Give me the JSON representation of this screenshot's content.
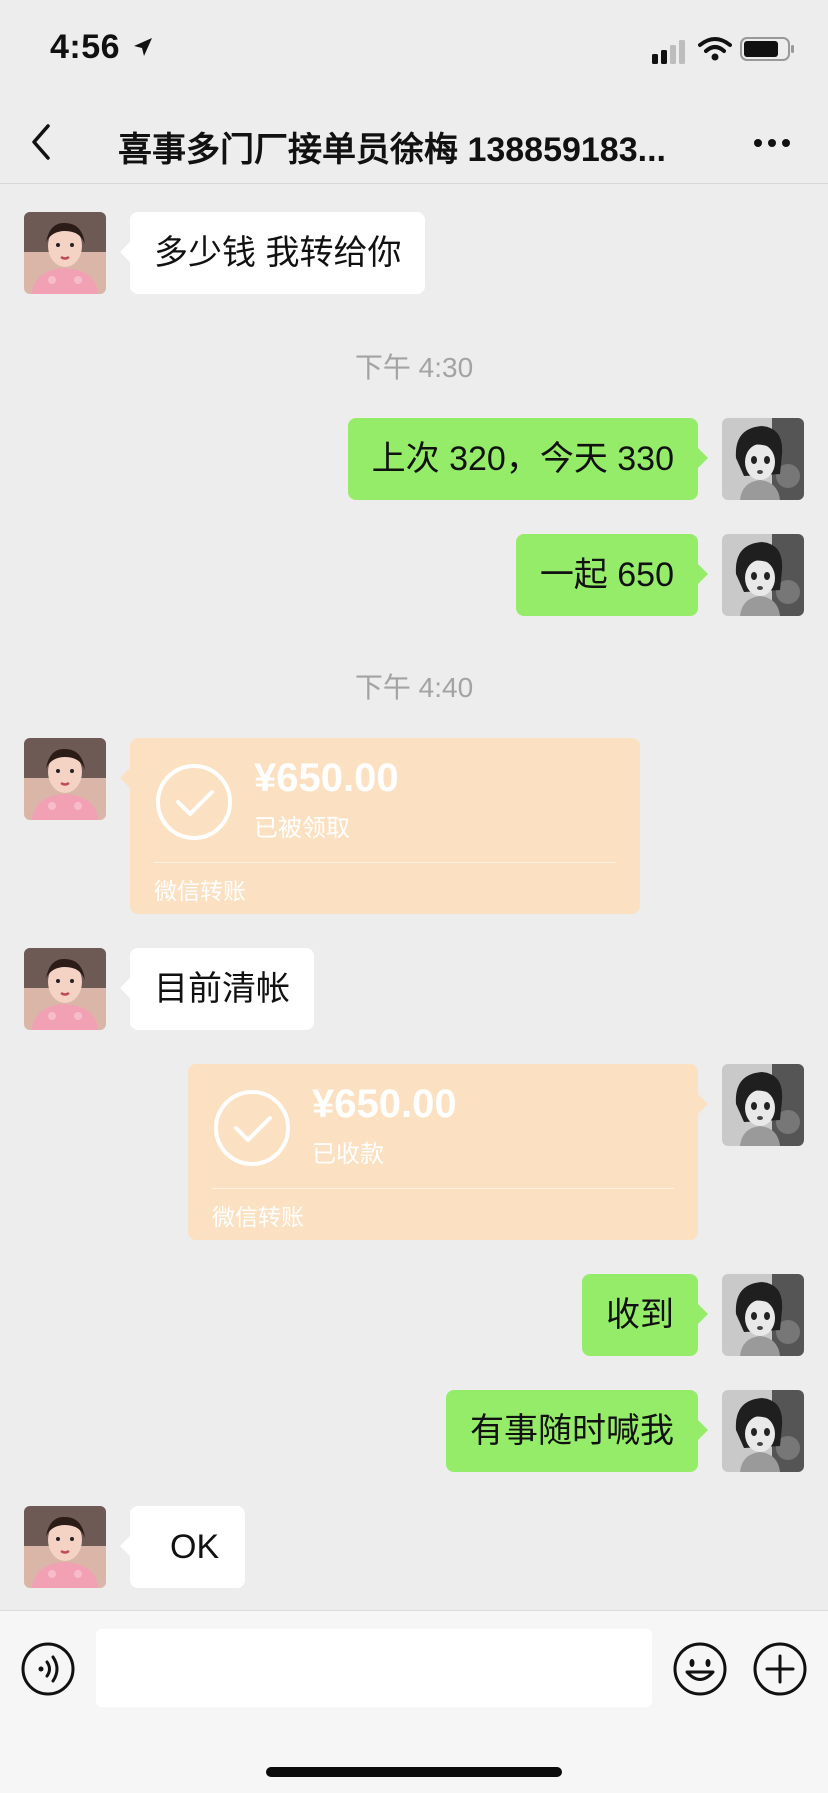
{
  "status_bar": {
    "time": "4:56"
  },
  "header": {
    "title": "喜事多门厂接单员徐梅 138859183..."
  },
  "messages": [
    {
      "type": "text",
      "side": "left",
      "text": "多少钱  我转给你"
    },
    {
      "type": "time",
      "text": "下午 4:30"
    },
    {
      "type": "text",
      "side": "right",
      "text": "上次 320，今天 330"
    },
    {
      "type": "text",
      "side": "right",
      "text": "一起 650"
    },
    {
      "type": "time",
      "text": "下午 4:40"
    },
    {
      "type": "transfer",
      "side": "left",
      "amount": "¥650.00",
      "status": "已被领取",
      "footer": "微信转账"
    },
    {
      "type": "text",
      "side": "left",
      "text": "目前清帐"
    },
    {
      "type": "transfer",
      "side": "right",
      "amount": "¥650.00",
      "status": "已收款",
      "footer": "微信转账"
    },
    {
      "type": "text",
      "side": "right",
      "text": "收到"
    },
    {
      "type": "text",
      "side": "right",
      "text": "有事随时喊我"
    },
    {
      "type": "text",
      "side": "left",
      "text": "OK"
    }
  ],
  "input": {
    "value": "",
    "placeholder": ""
  },
  "colors": {
    "background": "#ededed",
    "bubble_self": "#95ec69",
    "bubble_other": "#ffffff",
    "transfer_card": "#fbe1c1",
    "timestamp_text": "#a3a3a3"
  },
  "icons": [
    "location-arrow-icon",
    "signal-icon",
    "wifi-icon",
    "battery-icon",
    "back-chevron-icon",
    "more-icon",
    "check-circle-icon",
    "voice-icon",
    "emoji-icon",
    "plus-icon"
  ]
}
